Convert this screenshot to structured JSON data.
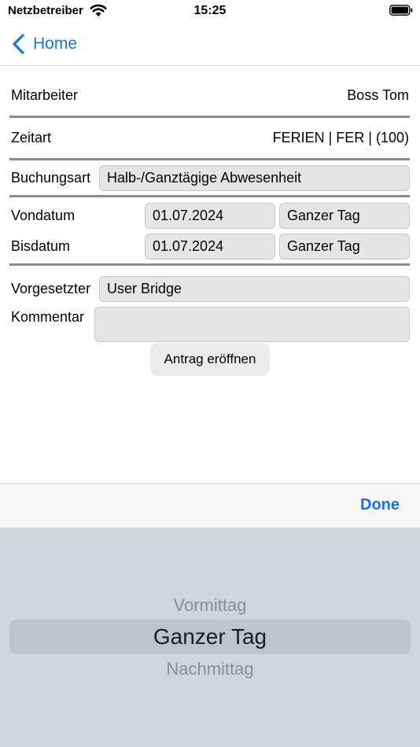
{
  "status_bar": {
    "carrier": "Netzbetreiber",
    "time": "15:25"
  },
  "nav": {
    "back_label": "Home"
  },
  "form": {
    "mitarbeiter_label": "Mitarbeiter",
    "mitarbeiter_value": "Boss Tom",
    "zeitart_label": "Zeitart",
    "zeitart_value": "FERIEN | FER | (100)",
    "buchungsart_label": "Buchungsart",
    "buchungsart_value": "Halb-/Ganztägige Abwesenheit",
    "vondatum_label": "Vondatum",
    "vondatum_date": "01.07.2024",
    "vondatum_period": "Ganzer Tag",
    "bisdatum_label": "Bisdatum",
    "bisdatum_date": "01.07.2024",
    "bisdatum_period": "Ganzer Tag",
    "vorgesetzter_label": "Vorgesetzter",
    "vorgesetzter_value": "User Bridge",
    "kommentar_label": "Kommentar",
    "kommentar_value": "",
    "submit_label": "Antrag eröffnen"
  },
  "picker": {
    "done_label": "Done",
    "options": [
      "Vormittag",
      "Ganzer Tag",
      "Nachmittag"
    ],
    "selected": "Ganzer Tag"
  },
  "colors": {
    "accent": "#1a73e8",
    "picker_bg": "#d1d4d9"
  }
}
